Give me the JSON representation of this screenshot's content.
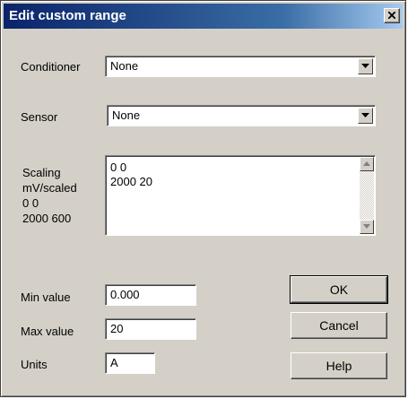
{
  "window": {
    "title": "Edit custom range",
    "close_icon": "close-icon"
  },
  "conditioner": {
    "label": "Conditioner",
    "value": "None"
  },
  "sensor": {
    "label": "Sensor",
    "value": "None"
  },
  "scaling": {
    "label_lines": [
      "Scaling",
      "mV/scaled",
      "0 0",
      "2000 600"
    ],
    "text_lines": [
      "0 0",
      "2000 20"
    ]
  },
  "min_value": {
    "label": "Min value",
    "value": "0.000"
  },
  "max_value": {
    "label": "Max value",
    "value": "20"
  },
  "units": {
    "label": "Units",
    "value": "A"
  },
  "buttons": {
    "ok": "OK",
    "cancel": "Cancel",
    "help": "Help"
  }
}
